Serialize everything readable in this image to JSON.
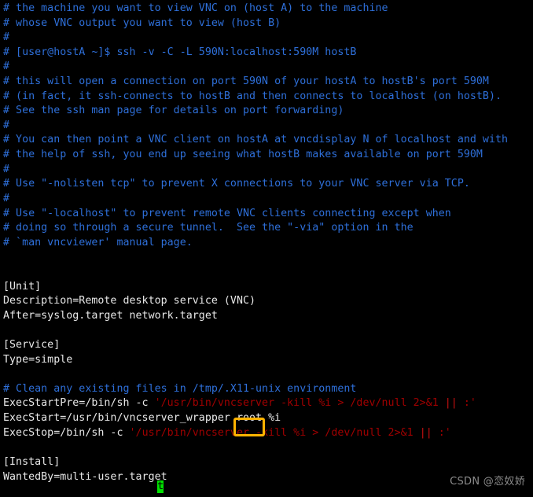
{
  "terminal": {
    "background_color": "#000000",
    "comment_color": "#2E6FD9",
    "text_color": "#E8E8E8",
    "string_color": "#A00000",
    "operator_color": "#C81010",
    "highlight_box_color": "#FFB300",
    "cursor_color": "#00E000",
    "lines": [
      {
        "id": "l01",
        "color": "comment",
        "text": "# the machine you want to view VNC on (host A) to the machine"
      },
      {
        "id": "l02",
        "color": "comment",
        "text": "# whose VNC output you want to view (host B)"
      },
      {
        "id": "l03",
        "color": "comment",
        "text": "#"
      },
      {
        "id": "l04",
        "color": "comment",
        "text": "# [user@hostA ~]$ ssh -v -C -L 590N:localhost:590M hostB"
      },
      {
        "id": "l05",
        "color": "comment",
        "text": "#"
      },
      {
        "id": "l06",
        "color": "comment",
        "text": "# this will open a connection on port 590N of your hostA to hostB's port 590M"
      },
      {
        "id": "l07",
        "color": "comment",
        "text": "# (in fact, it ssh-connects to hostB and then connects to localhost (on hostB)."
      },
      {
        "id": "l08",
        "color": "comment",
        "text": "# See the ssh man page for details on port forwarding)"
      },
      {
        "id": "l09",
        "color": "comment",
        "text": "#"
      },
      {
        "id": "l10",
        "color": "comment",
        "text": "# You can then point a VNC client on hostA at vncdisplay N of localhost and with"
      },
      {
        "id": "l11",
        "color": "comment",
        "text": "# the help of ssh, you end up seeing what hostB makes available on port 590M"
      },
      {
        "id": "l12",
        "color": "comment",
        "text": "#"
      },
      {
        "id": "l13",
        "color": "comment",
        "text": "# Use \"-nolisten tcp\" to prevent X connections to your VNC server via TCP."
      },
      {
        "id": "l14",
        "color": "comment",
        "text": "#"
      },
      {
        "id": "l15",
        "color": "comment",
        "text": "# Use \"-localhost\" to prevent remote VNC clients connecting except when"
      },
      {
        "id": "l16",
        "color": "comment",
        "text": "# doing so through a secure tunnel.  See the \"-via\" option in the"
      },
      {
        "id": "l17",
        "color": "comment",
        "text": "# `man vncviewer' manual page."
      },
      {
        "id": "l18",
        "color": "plain",
        "text": ""
      },
      {
        "id": "l19",
        "color": "plain",
        "text": ""
      },
      {
        "id": "l20",
        "color": "plain",
        "text": "[Unit]"
      },
      {
        "id": "l21",
        "color": "plain",
        "text": "Description=Remote desktop service (VNC)"
      },
      {
        "id": "l22",
        "color": "plain",
        "text": "After=syslog.target network.target"
      },
      {
        "id": "l23",
        "color": "plain",
        "text": ""
      },
      {
        "id": "l24",
        "color": "plain",
        "text": "[Service]"
      },
      {
        "id": "l25",
        "color": "plain",
        "text": "Type=simple"
      },
      {
        "id": "l26",
        "color": "plain",
        "text": ""
      },
      {
        "id": "l27",
        "color": "comment",
        "text": "# Clean any existing files in /tmp/.X11-unix environment"
      },
      {
        "id": "l28",
        "color": "mixed",
        "segments": [
          {
            "color": "plain",
            "text": "ExecStartPre=/bin/sh -c "
          },
          {
            "color": "string",
            "text": "'/usr/bin/vncserver -kill %i > /dev/null 2>&1 "
          },
          {
            "color": "op",
            "text": "||"
          },
          {
            "color": "string",
            "text": " :'"
          }
        ]
      },
      {
        "id": "l29",
        "color": "mixed",
        "segments": [
          {
            "color": "plain",
            "text": "ExecStart=/usr/bin/vncserver_wrapper root %i"
          }
        ]
      },
      {
        "id": "l30",
        "color": "mixed",
        "segments": [
          {
            "color": "plain",
            "text": "ExecStop=/bin/sh -c "
          },
          {
            "color": "string",
            "text": "'/usr/bin/vncserver -kill %i > /dev/null 2>&1 "
          },
          {
            "color": "op",
            "text": "||"
          },
          {
            "color": "string",
            "text": " :'"
          }
        ]
      },
      {
        "id": "l31",
        "color": "plain",
        "text": ""
      },
      {
        "id": "l32",
        "color": "plain",
        "text": "[Install]"
      },
      {
        "id": "l33",
        "color": "plain",
        "text": "WantedBy=multi-user.target"
      }
    ]
  },
  "annotations": {
    "highlight_box": {
      "label": "root",
      "target_text": "root",
      "line_id": "l29"
    },
    "cursor": {
      "character": "t",
      "line_id": "l33"
    }
  },
  "watermark": {
    "text": "CSDN @恋奴娇"
  }
}
